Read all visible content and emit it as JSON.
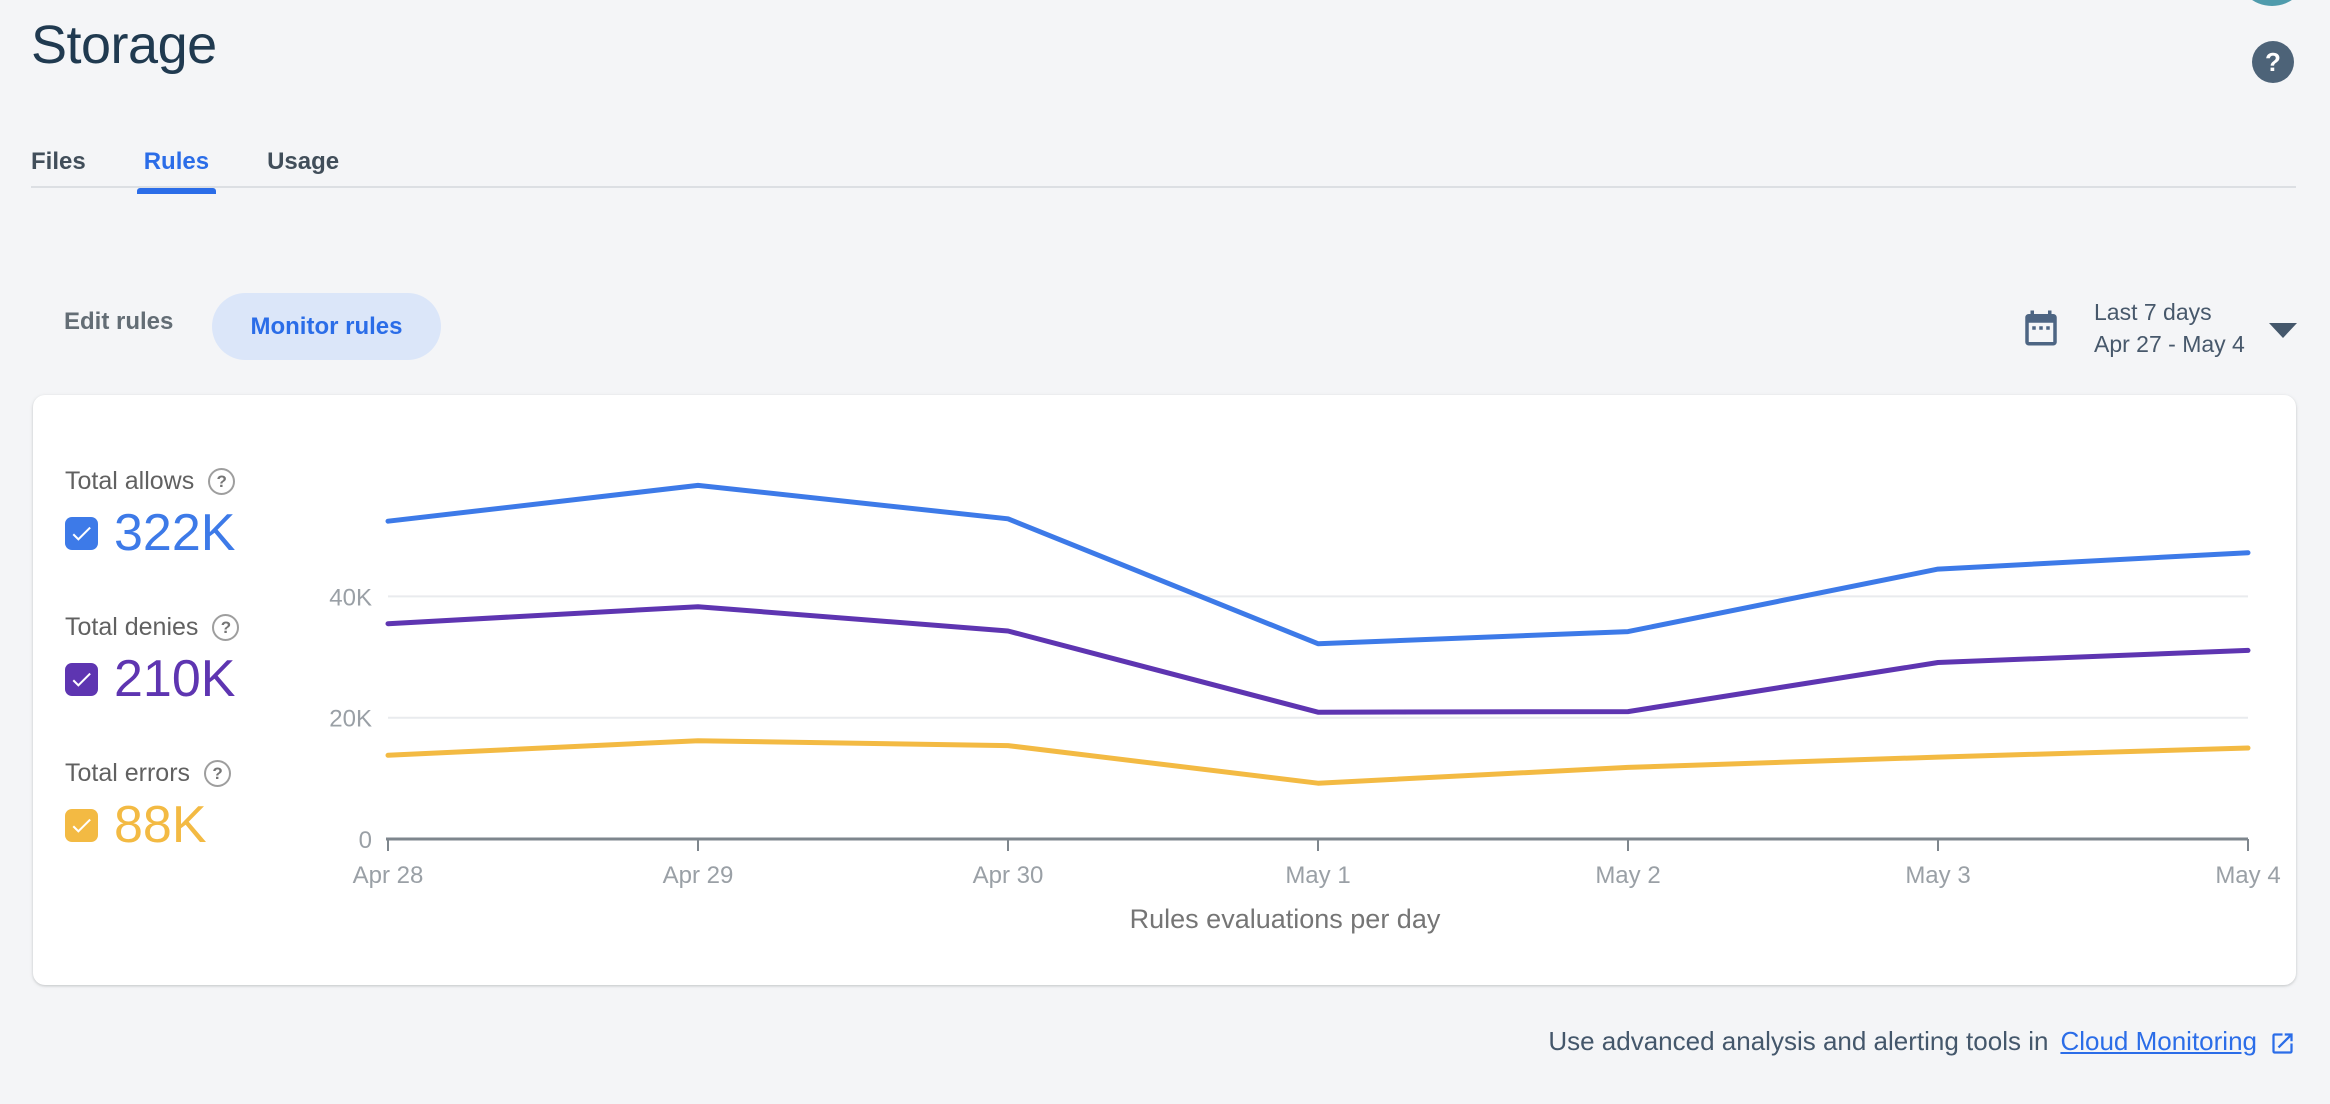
{
  "header": {
    "title": "Storage"
  },
  "icons": {
    "help_glyph": "?"
  },
  "tabs": [
    {
      "label": "Files",
      "active": false
    },
    {
      "label": "Rules",
      "active": true
    },
    {
      "label": "Usage",
      "active": false
    }
  ],
  "toolbar": {
    "edit_rules_label": "Edit rules",
    "monitor_rules_label": "Monitor rules"
  },
  "date_range": {
    "preset": "Last 7 days",
    "range": "Apr 27 - May 4"
  },
  "legend": [
    {
      "label": "Total allows",
      "value": "322K",
      "color": "#3d7ae8",
      "checked": true
    },
    {
      "label": "Total denies",
      "value": "210K",
      "color": "#5e35b1",
      "checked": true
    },
    {
      "label": "Total errors",
      "value": "88K",
      "color": "#f3ba43",
      "checked": true
    }
  ],
  "chart_data": {
    "type": "line",
    "title": "Rules evaluations per day",
    "categories": [
      "Apr 28",
      "Apr 29",
      "Apr 30",
      "May 1",
      "May 2",
      "May 3",
      "May 4"
    ],
    "series": [
      {
        "name": "Total allows",
        "color": "#3d7ae8",
        "values": [
          52400,
          58300,
          52800,
          32200,
          34200,
          44500,
          47200
        ]
      },
      {
        "name": "Total denies",
        "color": "#5e35b1",
        "values": [
          35500,
          38300,
          34300,
          20900,
          21000,
          29100,
          31100
        ]
      },
      {
        "name": "Total errors",
        "color": "#f3ba43",
        "values": [
          13800,
          16200,
          15400,
          9200,
          11800,
          13500,
          15000
        ]
      }
    ],
    "ylim": [
      0,
      50000
    ],
    "yticks": [
      {
        "value": 0,
        "label": "0"
      },
      {
        "value": 20000,
        "label": "20K"
      },
      {
        "value": 40000,
        "label": "40K"
      }
    ],
    "grid": "horizontal",
    "legend_position": "left"
  },
  "footer": {
    "prefix": "Use advanced analysis and alerting tools in",
    "link_label": "Cloud Monitoring"
  }
}
